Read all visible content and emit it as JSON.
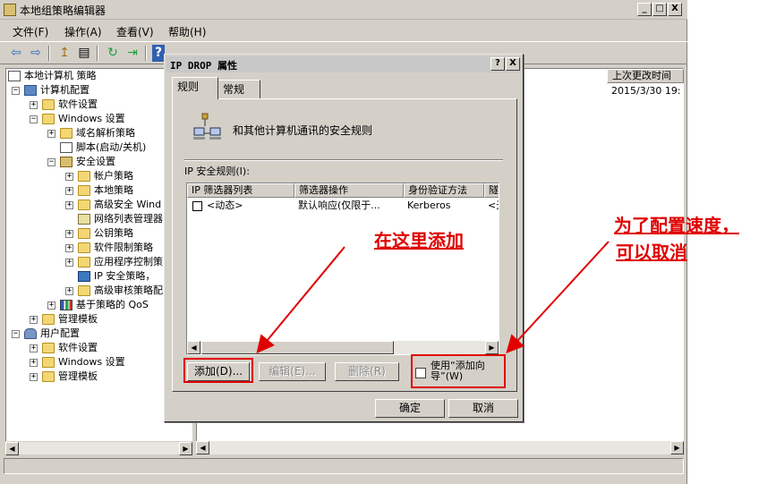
{
  "window": {
    "title": "本地组策略编辑器",
    "minimize": "_",
    "maximize": "□",
    "close": "X"
  },
  "menu": [
    {
      "label": "文件(F)"
    },
    {
      "label": "操作(A)"
    },
    {
      "label": "查看(V)"
    },
    {
      "label": "帮助(H)"
    }
  ],
  "toolbar": {
    "back": "⇦",
    "forward": "⇨",
    "up": "↥",
    "show_tree": "▤",
    "refresh": "↻",
    "export": "⇥",
    "help": "?"
  },
  "tree": [
    {
      "label": "本地计算机 策略"
    },
    {
      "label": "计算机配置"
    },
    {
      "label": "软件设置"
    },
    {
      "label": "Windows 设置"
    },
    {
      "label": "域名解析策略"
    },
    {
      "label": "脚本(启动/关机)"
    },
    {
      "label": "安全设置"
    },
    {
      "label": "帐户策略"
    },
    {
      "label": "本地策略"
    },
    {
      "label": "高级安全 Wind"
    },
    {
      "label": "网络列表管理器"
    },
    {
      "label": "公钥策略"
    },
    {
      "label": "软件限制策略"
    },
    {
      "label": "应用程序控制策"
    },
    {
      "label": "IP 安全策略，"
    },
    {
      "label": "高级审核策略配"
    },
    {
      "label": "基于策略的 QoS"
    },
    {
      "label": "管理模板"
    },
    {
      "label": "用户配置"
    },
    {
      "label": "软件设置"
    },
    {
      "label": "Windows 设置"
    },
    {
      "label": "管理模板"
    }
  ],
  "right_pane": {
    "column_header": "上次更改时间",
    "cell": "2015/3/30 19:"
  },
  "dialog": {
    "title": "IP DROP 属性",
    "help_btn": "?",
    "close_btn": "X",
    "tabs": [
      {
        "label": "规则"
      },
      {
        "label": "常规"
      }
    ],
    "description": "和其他计算机通讯的安全规则",
    "rules_label": "IP 安全规则(I):",
    "columns": [
      "IP 筛选器列表",
      "筛选器操作",
      "身份验证方法",
      "隧"
    ],
    "rows": [
      {
        "filter_list": "<动态>",
        "action": "默认响应(仅限于...",
        "auth": "Kerberos",
        "tunnel": "<无"
      }
    ],
    "buttons": {
      "add": "添加(D)...",
      "edit": "编辑(E)...",
      "delete": "删除(R)",
      "ok": "确定",
      "cancel": "取消"
    },
    "use_wizard": "使用“添加向导”(W)"
  },
  "annotations": {
    "add_here": "在这里添加",
    "cancel_note_1": "为了配置速度，",
    "cancel_note_2": "可以取消",
    "color": "#e00000"
  }
}
